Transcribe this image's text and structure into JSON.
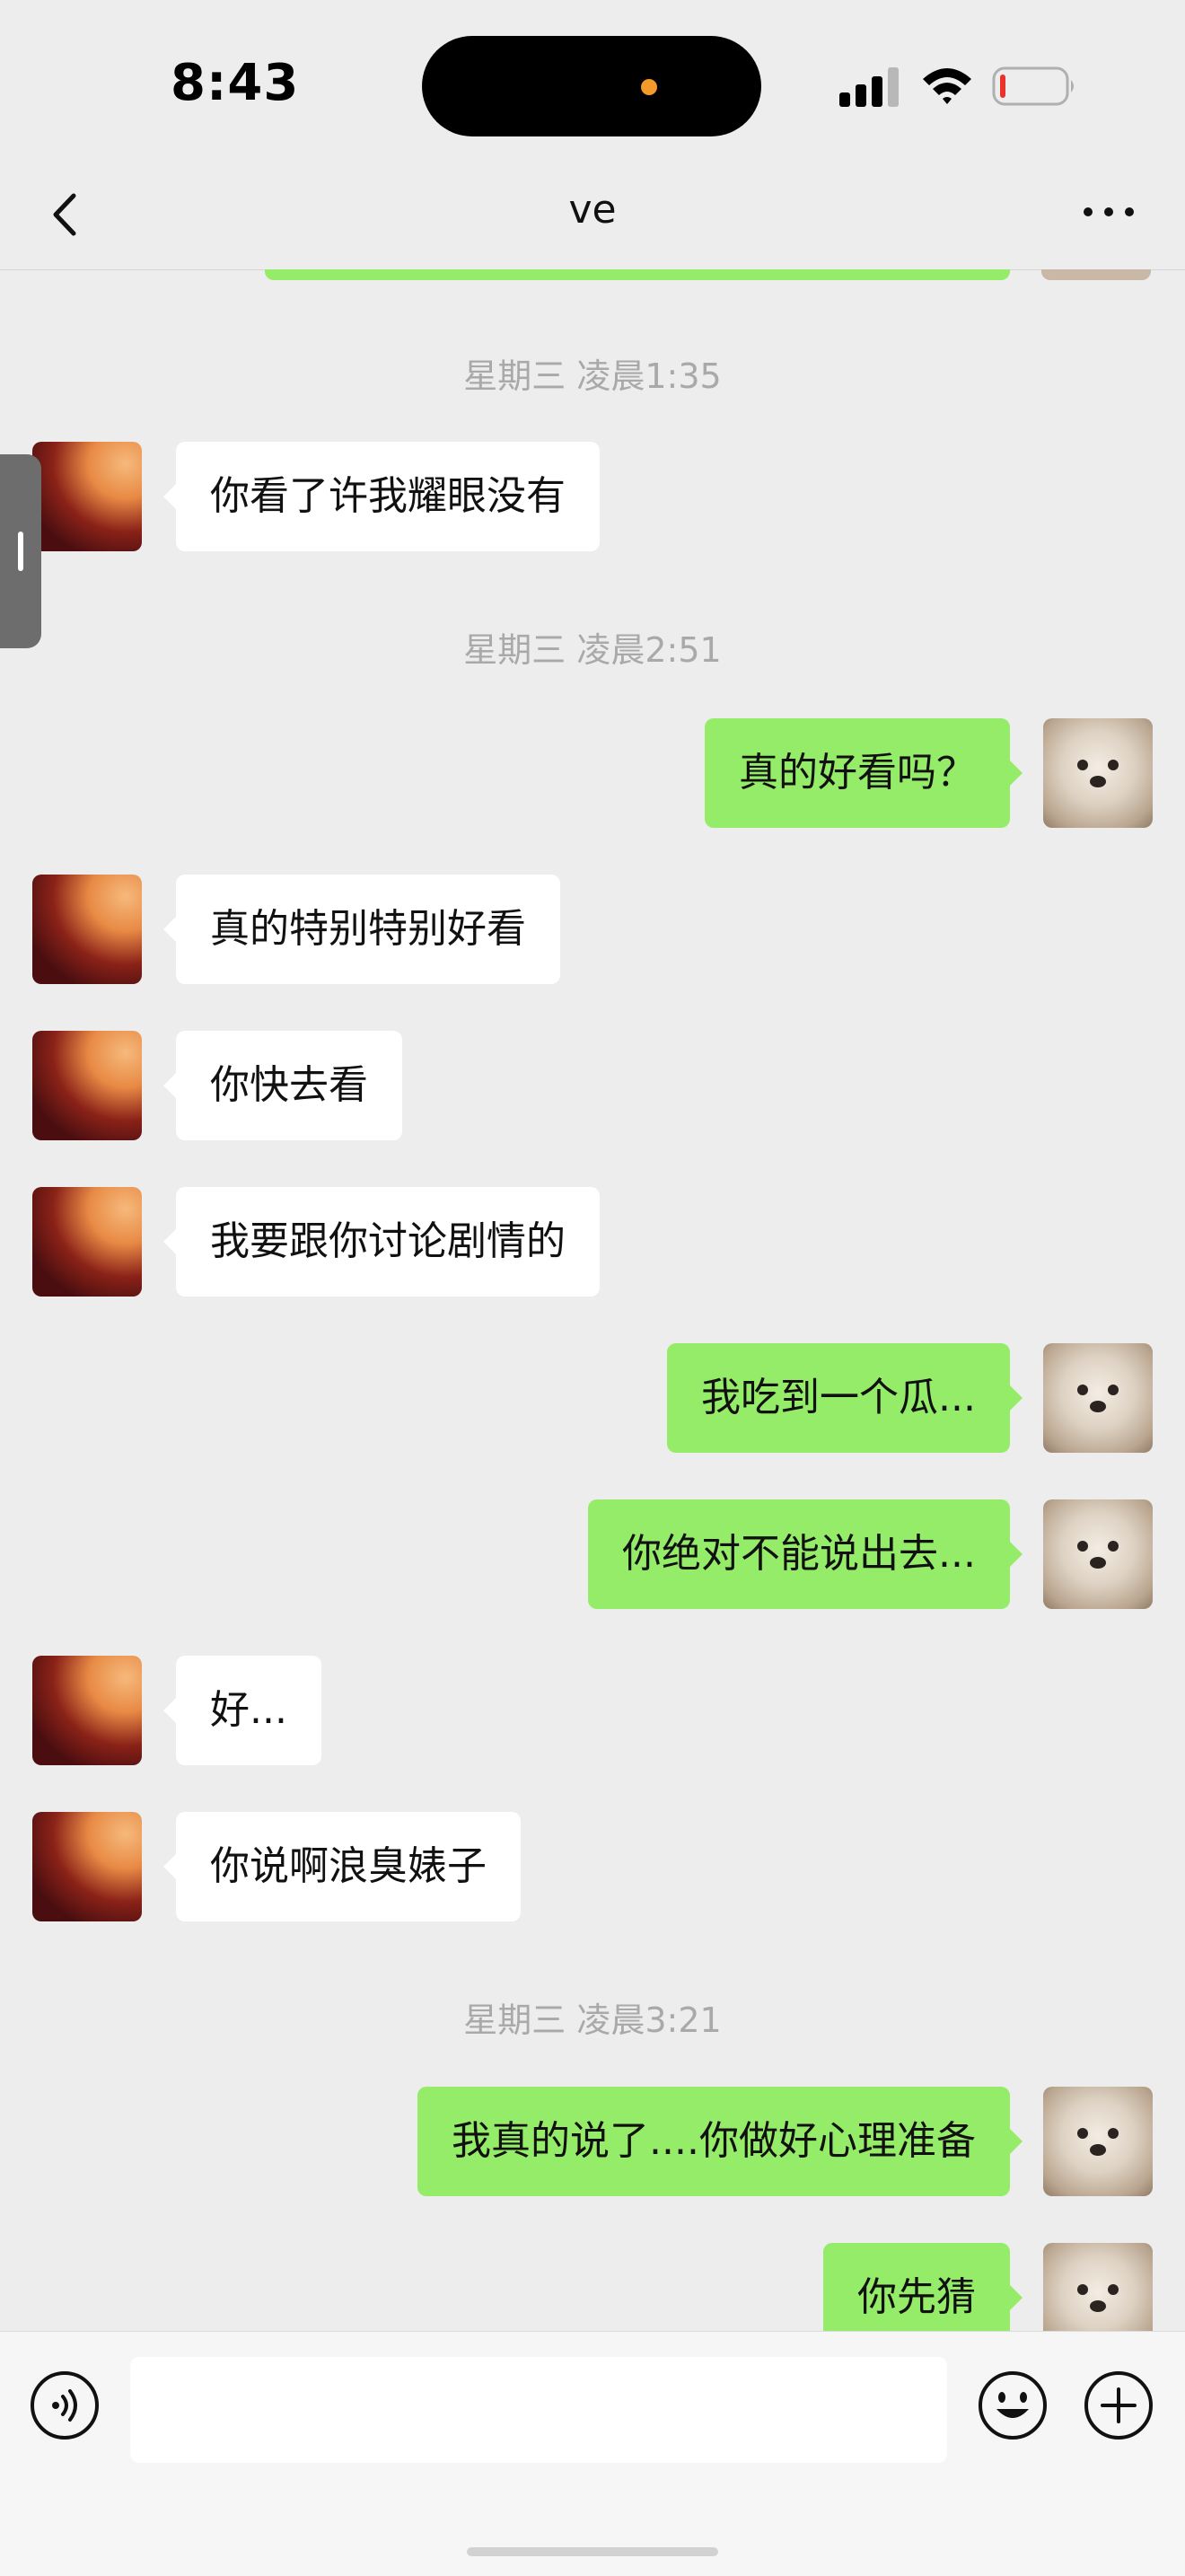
{
  "status_bar": {
    "time": "8:43",
    "icons": [
      "signal-icon",
      "wifi-icon",
      "battery-low-icon"
    ],
    "indicator_color": "#f39a2a"
  },
  "nav": {
    "title": "ve",
    "back_icon": "chevron-left-icon",
    "more_icon": "ellipsis-icon"
  },
  "colors": {
    "sent_bubble": "#95ec69",
    "received_bubble": "#ffffff",
    "background": "#ededed",
    "timestamp": "#a9a9a9"
  },
  "timestamps": [
    "星期三 凌晨1:35",
    "星期三 凌晨2:51",
    "星期三 凌晨3:21"
  ],
  "messages": [
    {
      "side": "left",
      "text": "你看了许我耀眼没有"
    },
    {
      "side": "right",
      "text": "真的好看吗？"
    },
    {
      "side": "left",
      "text": "真的特别特别好看"
    },
    {
      "side": "left",
      "text": "你快去看"
    },
    {
      "side": "left",
      "text": "我要跟你讨论剧情的"
    },
    {
      "side": "right",
      "text": "我吃到一个瓜..."
    },
    {
      "side": "right",
      "text": "你绝对不能说出去..."
    },
    {
      "side": "left",
      "text": "好..."
    },
    {
      "side": "left",
      "text": "你说啊浪臭婊子"
    },
    {
      "side": "right",
      "text": "我真的说了....你做好心理准备"
    },
    {
      "side": "right",
      "text": "你先猜"
    }
  ],
  "input_bar": {
    "text_value": "",
    "icons": [
      "voice-icon",
      "emoji-icon",
      "plus-icon"
    ]
  }
}
